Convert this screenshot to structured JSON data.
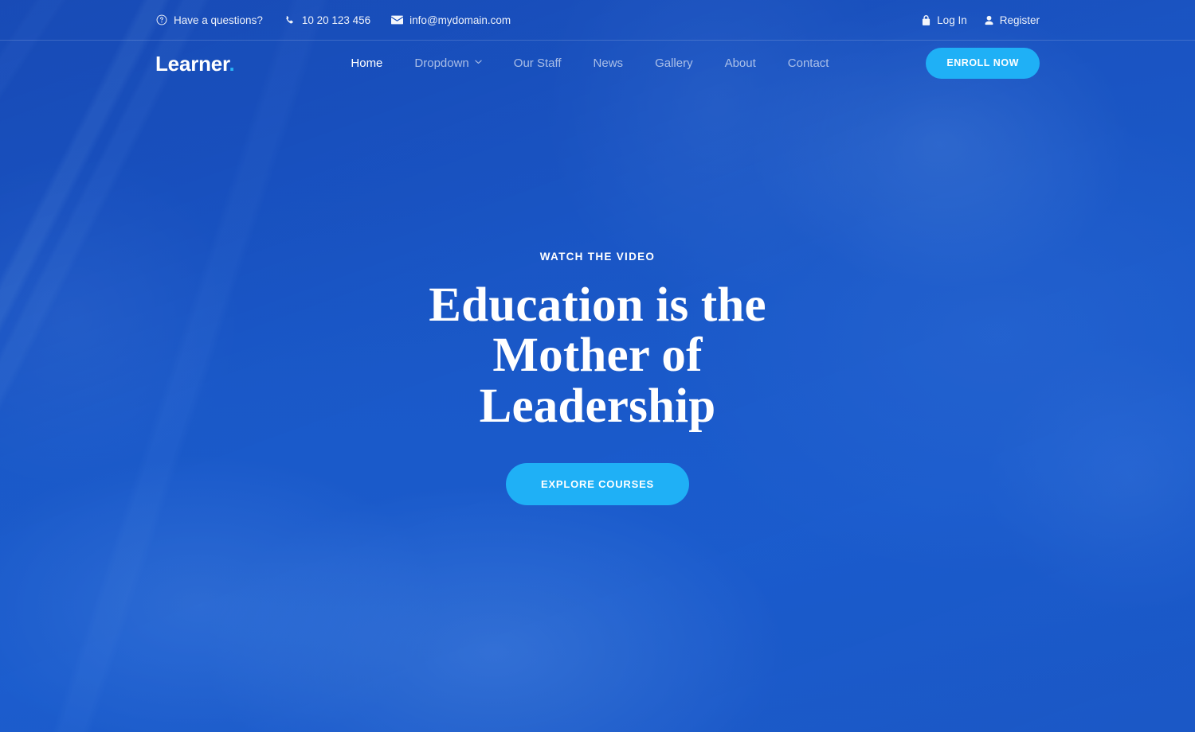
{
  "brand": {
    "name": "Learner",
    "dot": "."
  },
  "topbar": {
    "contact_items": [
      {
        "icon": "question-circle-icon",
        "text": "Have a questions?"
      },
      {
        "icon": "phone-icon",
        "text": "10 20 123 456"
      },
      {
        "icon": "envelope-icon",
        "text": "info@mydomain.com"
      }
    ],
    "auth": [
      {
        "icon": "lock-icon",
        "label": "Log In"
      },
      {
        "icon": "user-icon",
        "label": "Register"
      }
    ]
  },
  "nav": {
    "links": [
      {
        "label": "Home",
        "active": true,
        "caret": false
      },
      {
        "label": "Dropdown",
        "active": false,
        "caret": true
      },
      {
        "label": "Our Staff",
        "active": false,
        "caret": false
      },
      {
        "label": "News",
        "active": false,
        "caret": false
      },
      {
        "label": "Gallery",
        "active": false,
        "caret": false
      },
      {
        "label": "About",
        "active": false,
        "caret": false
      },
      {
        "label": "Contact",
        "active": false,
        "caret": false
      }
    ],
    "cta_label": "ENROLL NOW"
  },
  "hero": {
    "eyebrow": "WATCH THE VIDEO",
    "title_line1": "Education is the",
    "title_line2": "Mother of",
    "title_line3": "Leadership",
    "cta_label": "EXPLORE COURSES"
  },
  "colors": {
    "accent": "#1fb0f6",
    "overlay_blue": "#2a6fd4",
    "text_white": "#ffffff",
    "nav_inactive": "rgba(255,255,255,0.62)"
  }
}
